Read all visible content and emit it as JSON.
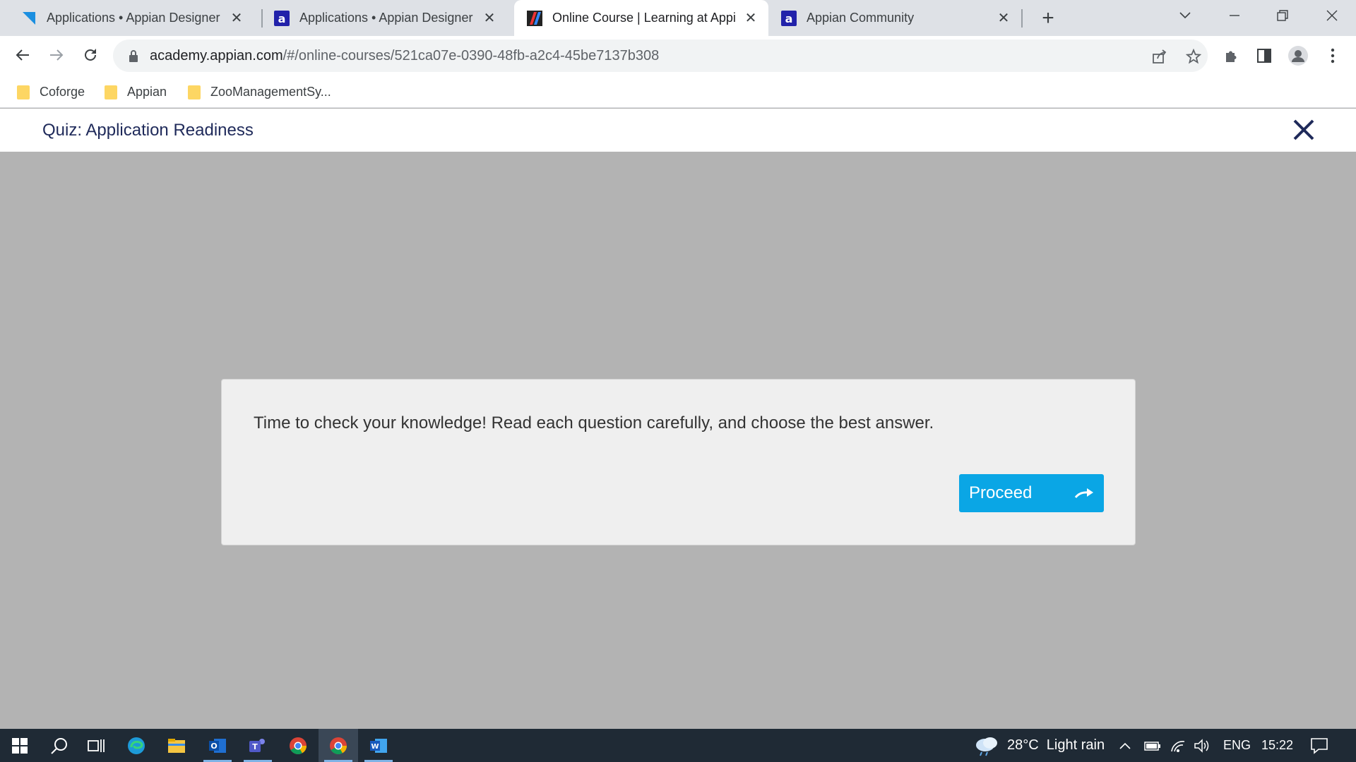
{
  "browser": {
    "tabs": [
      {
        "title": "Applications • Appian Designer",
        "favicon": "appian-designer-icon",
        "active": false
      },
      {
        "title": "Applications • Appian Designer",
        "favicon": "appian-a-icon",
        "active": false
      },
      {
        "title": "Online Course | Learning at Appi",
        "favicon": "appian-academy-icon",
        "active": true
      },
      {
        "title": "Appian Community",
        "favicon": "appian-a-icon",
        "active": false
      }
    ],
    "url_host": "academy.appian.com",
    "url_path": "/#/online-courses/521ca07e-0390-48fb-a2c4-45be7137b308",
    "bookmarks": [
      {
        "label": "Coforge"
      },
      {
        "label": "Appian"
      },
      {
        "label": "ZooManagementSy..."
      }
    ]
  },
  "app": {
    "quiz_title": "Quiz: Application Readiness",
    "message": "Time to check your knowledge! Read each question carefully, and choose the best answer.",
    "proceed_label": "Proceed",
    "accent_color": "#0aa6e5"
  },
  "taskbar": {
    "weather": "28°C  Light rain",
    "language": "ENG",
    "time": "15:22"
  }
}
